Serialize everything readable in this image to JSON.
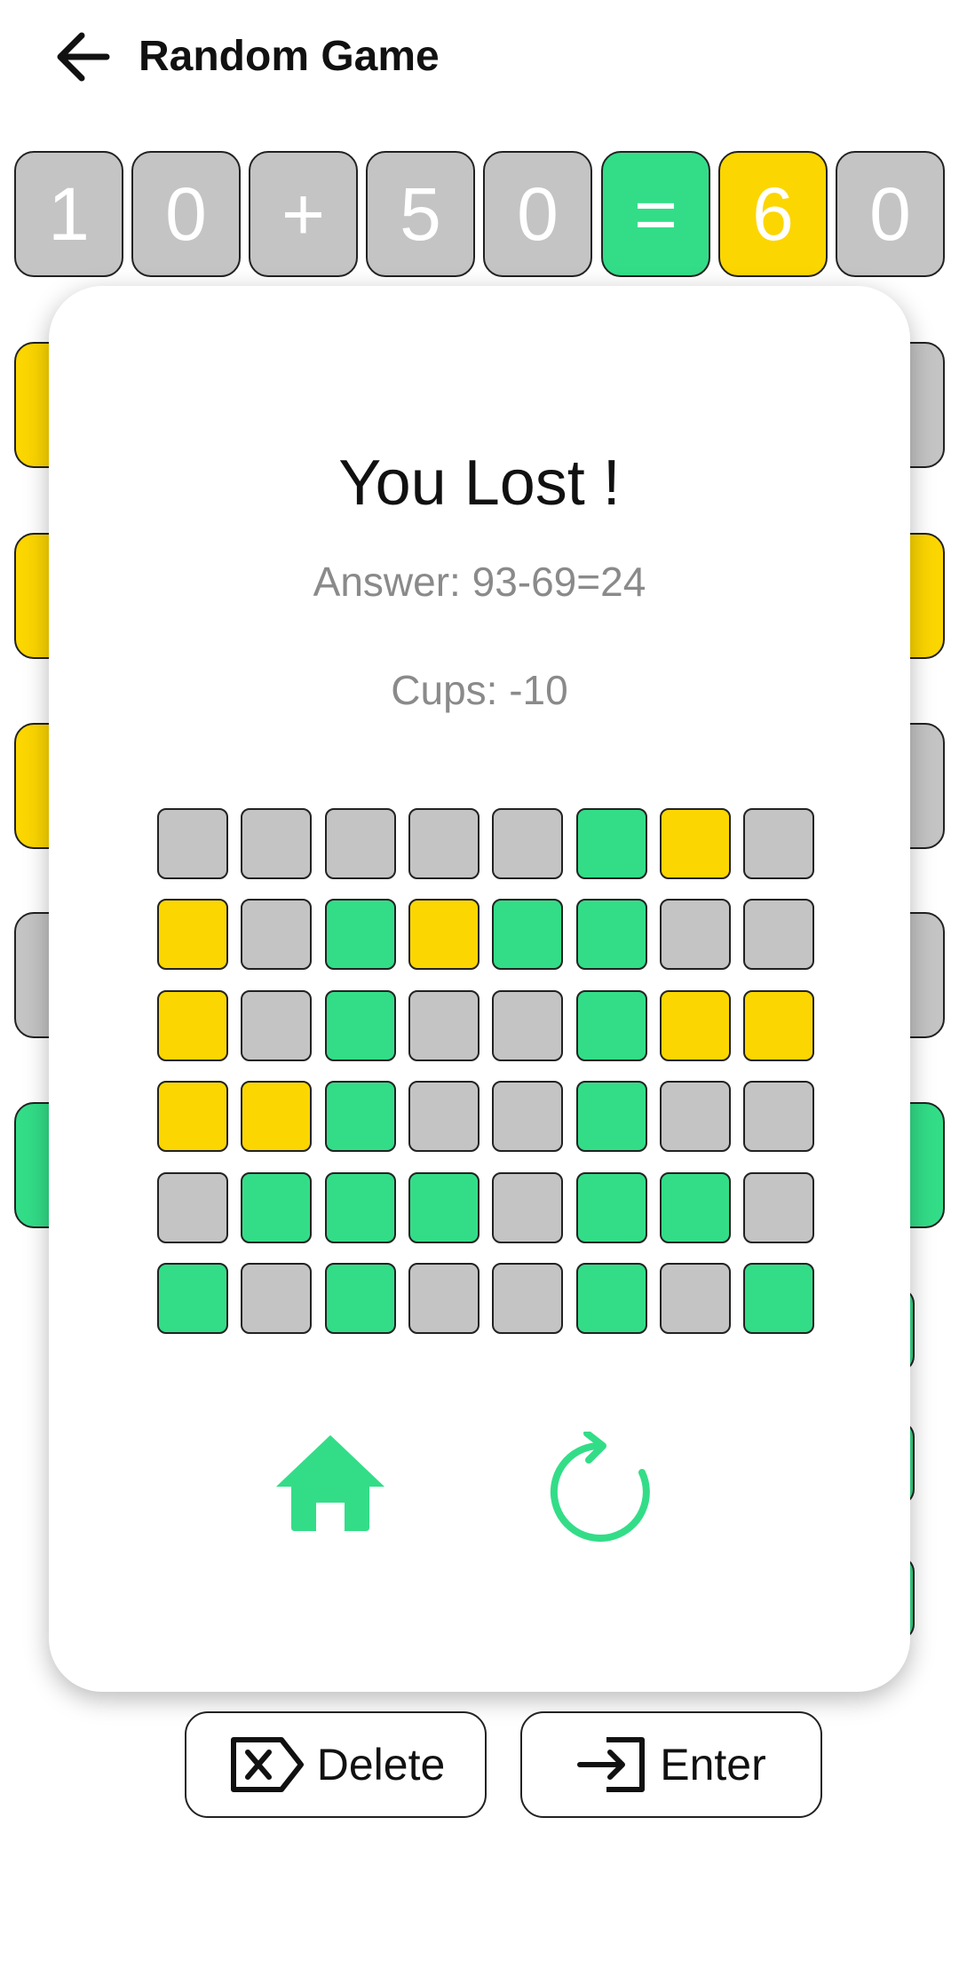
{
  "header": {
    "title": "Random Game"
  },
  "board": {
    "row1": [
      {
        "char": "1",
        "state": "gray"
      },
      {
        "char": "0",
        "state": "gray"
      },
      {
        "char": "+",
        "state": "gray"
      },
      {
        "char": "5",
        "state": "gray"
      },
      {
        "char": "0",
        "state": "gray"
      },
      {
        "char": "=",
        "state": "green"
      },
      {
        "char": "6",
        "state": "yellow"
      },
      {
        "char": "0",
        "state": "gray"
      }
    ],
    "peek_left_states": [
      "yellow",
      "yellow",
      "yellow",
      "gray",
      "green"
    ],
    "peek_right_states": [
      "gray",
      "yellow",
      "gray",
      "gray",
      "green"
    ]
  },
  "modal": {
    "title": "You Lost !",
    "answer": "Answer: 93-69=24",
    "cups": "Cups: -10",
    "grid": [
      [
        "gray",
        "gray",
        "gray",
        "gray",
        "gray",
        "green",
        "yellow",
        "gray"
      ],
      [
        "yellow",
        "gray",
        "green",
        "yellow",
        "green",
        "green",
        "gray",
        "gray"
      ],
      [
        "yellow",
        "gray",
        "green",
        "gray",
        "gray",
        "green",
        "yellow",
        "yellow"
      ],
      [
        "yellow",
        "yellow",
        "green",
        "gray",
        "gray",
        "green",
        "gray",
        "gray"
      ],
      [
        "gray",
        "green",
        "green",
        "green",
        "gray",
        "green",
        "green",
        "gray"
      ],
      [
        "green",
        "gray",
        "green",
        "gray",
        "gray",
        "green",
        "gray",
        "green"
      ]
    ],
    "home_icon": "home-icon",
    "restart_icon": "restart-icon"
  },
  "actions": {
    "delete_label": "Delete",
    "enter_label": "Enter"
  },
  "colors": {
    "green": "#33dd88",
    "yellow": "#fcd600",
    "gray": "#c4c4c4"
  }
}
